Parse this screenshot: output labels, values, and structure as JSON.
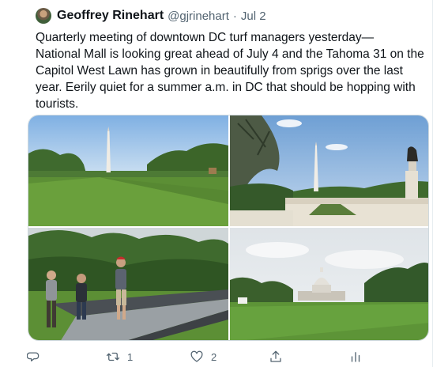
{
  "tweet": {
    "author_name": "Geoffrey Rinehart",
    "author_handle": "@gjrinehart",
    "separator": "·",
    "date": "Jul 2",
    "text": "Quarterly meeting of downtown DC turf managers yesterday—\nNational Mall is looking great ahead of July 4 and the Tahoma 31 on the\nCapitol West Lawn has grown in beautifully from sprigs over the last\nyear. Eerily quiet for a summer a.m. in DC that should be hopping with\ntourists."
  },
  "media": {
    "photos": [
      {
        "subject": "washington-monument-mall-lawn"
      },
      {
        "subject": "washington-monument-from-capitol"
      },
      {
        "subject": "turf-managers-group"
      },
      {
        "subject": "capitol-west-lawn"
      }
    ]
  },
  "actions": {
    "reply": {
      "icon": "reply-icon",
      "count": ""
    },
    "retweet": {
      "icon": "retweet-icon",
      "count": "1"
    },
    "like": {
      "icon": "heart-icon",
      "count": "2"
    },
    "share": {
      "icon": "share-icon",
      "count": ""
    },
    "analytics": {
      "icon": "analytics-icon",
      "count": ""
    }
  },
  "colors": {
    "text": "#0f1419",
    "secondary": "#536471",
    "border": "#cfd9de"
  }
}
